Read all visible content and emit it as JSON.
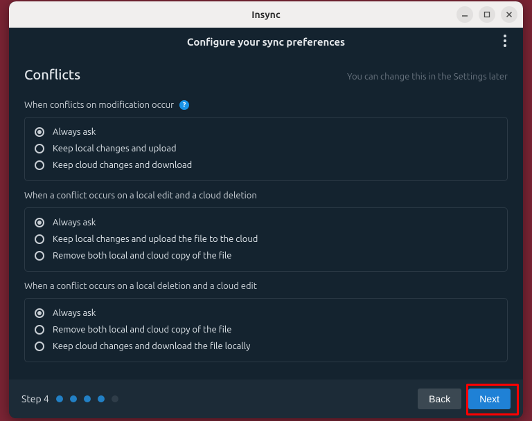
{
  "titlebar": {
    "title": "Insync"
  },
  "subheader": {
    "title": "Configure your sync preferences"
  },
  "page": {
    "title": "Conflicts",
    "hint": "You can change this in the Settings later"
  },
  "sections": [
    {
      "label": "When conflicts on modification occur",
      "has_help": true,
      "options": [
        {
          "label": "Always ask",
          "checked": true
        },
        {
          "label": "Keep local changes and upload",
          "checked": false
        },
        {
          "label": "Keep cloud changes and download",
          "checked": false
        }
      ]
    },
    {
      "label": "When a conflict occurs on a local edit and a cloud deletion",
      "has_help": false,
      "options": [
        {
          "label": "Always ask",
          "checked": true
        },
        {
          "label": "Keep local changes and upload the file to the cloud",
          "checked": false
        },
        {
          "label": "Remove both local and cloud copy of the file",
          "checked": false
        }
      ]
    },
    {
      "label": "When a conflict occurs on a local deletion and a cloud edit",
      "has_help": false,
      "options": [
        {
          "label": "Always ask",
          "checked": true
        },
        {
          "label": "Remove both local and cloud copy of the file",
          "checked": false
        },
        {
          "label": "Keep cloud changes and download the file locally",
          "checked": false
        }
      ]
    }
  ],
  "footer": {
    "step_label": "Step 4",
    "dots": [
      true,
      true,
      true,
      true,
      false
    ],
    "back": "Back",
    "next": "Next"
  }
}
